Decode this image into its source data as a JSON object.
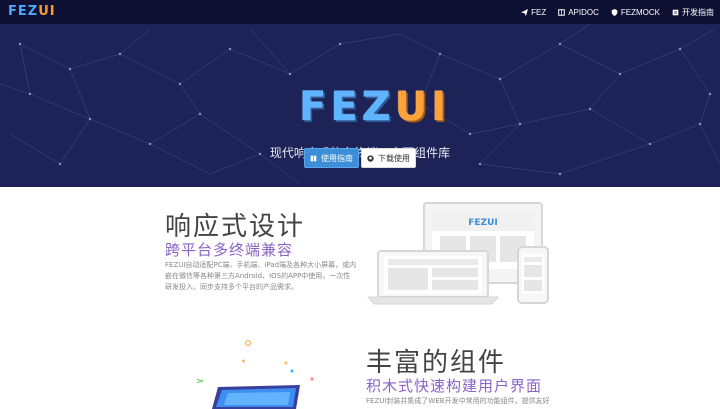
{
  "brand": {
    "fe": "FEZ",
    "ui": "UI"
  },
  "nav": {
    "links": [
      {
        "label": "FEZ",
        "icon": "paper-plane-icon"
      },
      {
        "label": "APIDOC",
        "icon": "book-icon"
      },
      {
        "label": "FEZMOCK",
        "icon": "shield-icon"
      },
      {
        "label": "开发指南",
        "icon": "document-icon"
      }
    ]
  },
  "hero": {
    "logo_fe": "FEZ",
    "logo_ui": "UI",
    "tagline": "现代响应式的多终端UI交互组件库",
    "primary_button": "使用指南",
    "secondary_button": "下载使用"
  },
  "section_responsive": {
    "title": "响应式设计",
    "subtitle": "跨平台多终端兼容",
    "description": "FEZUI自动适配PC端、手机端、iPad端及各种大小屏幕，或内嵌在微信等各种第三方Android、IOS的APP中使用，一次性研发投入，同步支持多个平台的产品需求。",
    "illustration_logo": "FEZUI"
  },
  "section_components": {
    "title": "丰富的组件",
    "subtitle": "积木式快速构建用户界面",
    "description": "FEZUI封装并集成了WEB开发中常用的功能组件，提供友好"
  },
  "colors": {
    "nav_bg": "#0d1033",
    "hero_bg": "#1d2257",
    "accent_blue": "#3b8ed7",
    "accent_orange": "#ffa23a",
    "subtitle_purple": "#8a63c7"
  }
}
